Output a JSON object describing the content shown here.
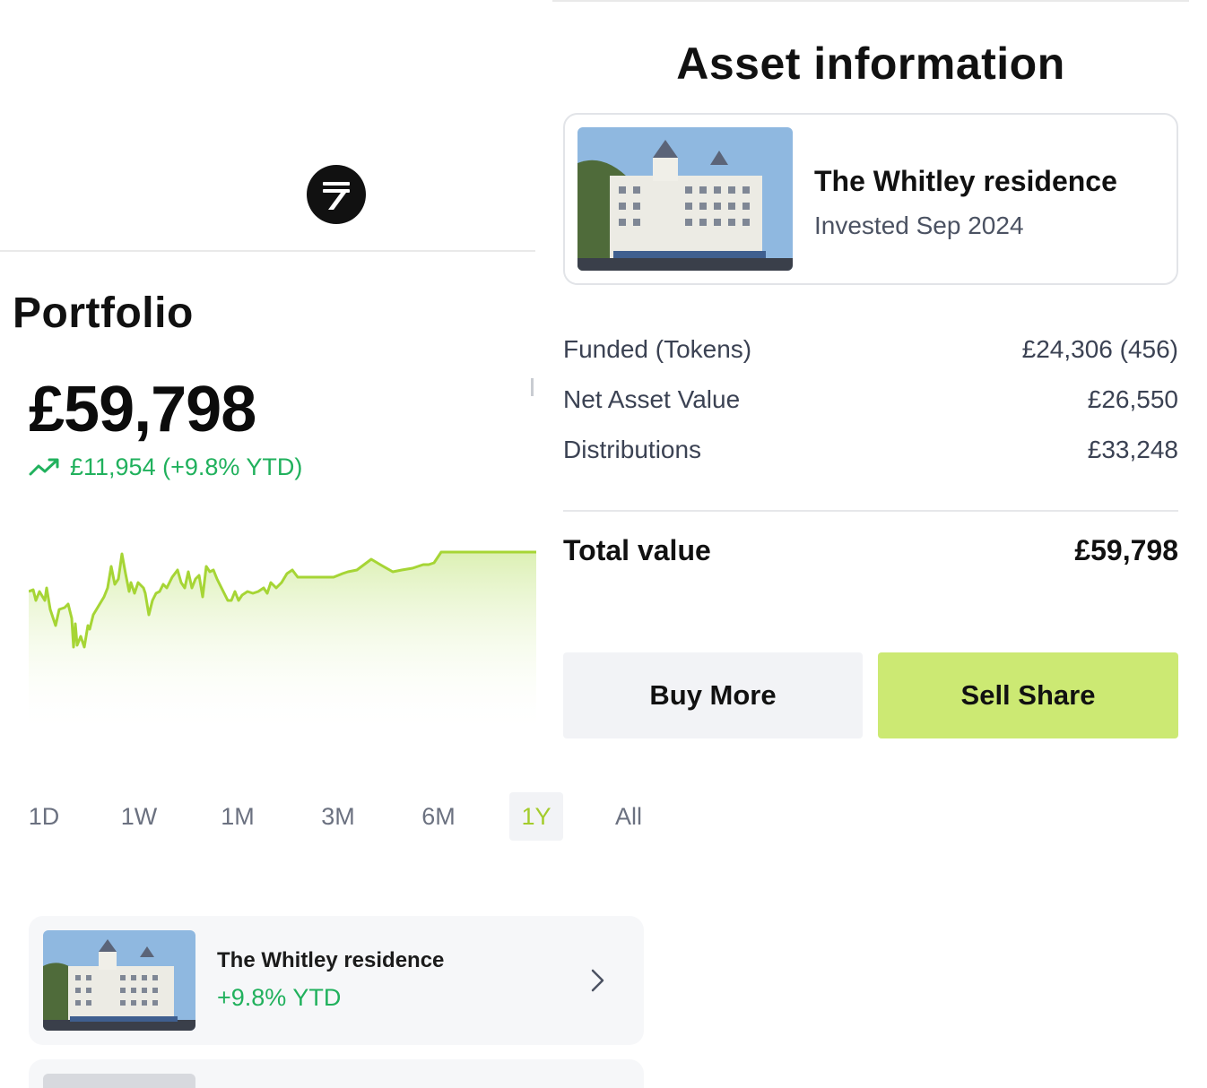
{
  "portfolio": {
    "title": "Portfolio",
    "balance": "£59,798",
    "change": "£11,954 (+9.8% YTD)",
    "change_color": "#21b15d",
    "chart_line_color": "#a6d535"
  },
  "range_tabs": {
    "items": [
      "1D",
      "1W",
      "1M",
      "3M",
      "6M",
      "1Y",
      "All"
    ],
    "active": "1Y",
    "active_color": "#a4cc2c"
  },
  "holdings": [
    {
      "name": "The Whitley residence",
      "ytd": "+9.8% YTD",
      "icon": "chevron-right-icon"
    }
  ],
  "asset": {
    "title": "Asset information",
    "name": "The Whitley residence",
    "invested": "Invested Sep 2024",
    "rows": [
      {
        "label": "Funded (Tokens)",
        "value": "£24,306 (456)"
      },
      {
        "label": "Net Asset Value",
        "value": "£26,550"
      },
      {
        "label": "Distributions",
        "value": "£33,248"
      }
    ],
    "total_label": "Total value",
    "total_value": "£59,798"
  },
  "actions": {
    "buy_label": "Buy More",
    "sell_label": "Sell Share",
    "sell_color": "#cce973"
  },
  "icons": {
    "logo": "brand-logo-icon",
    "trend": "trend-up-icon"
  }
}
